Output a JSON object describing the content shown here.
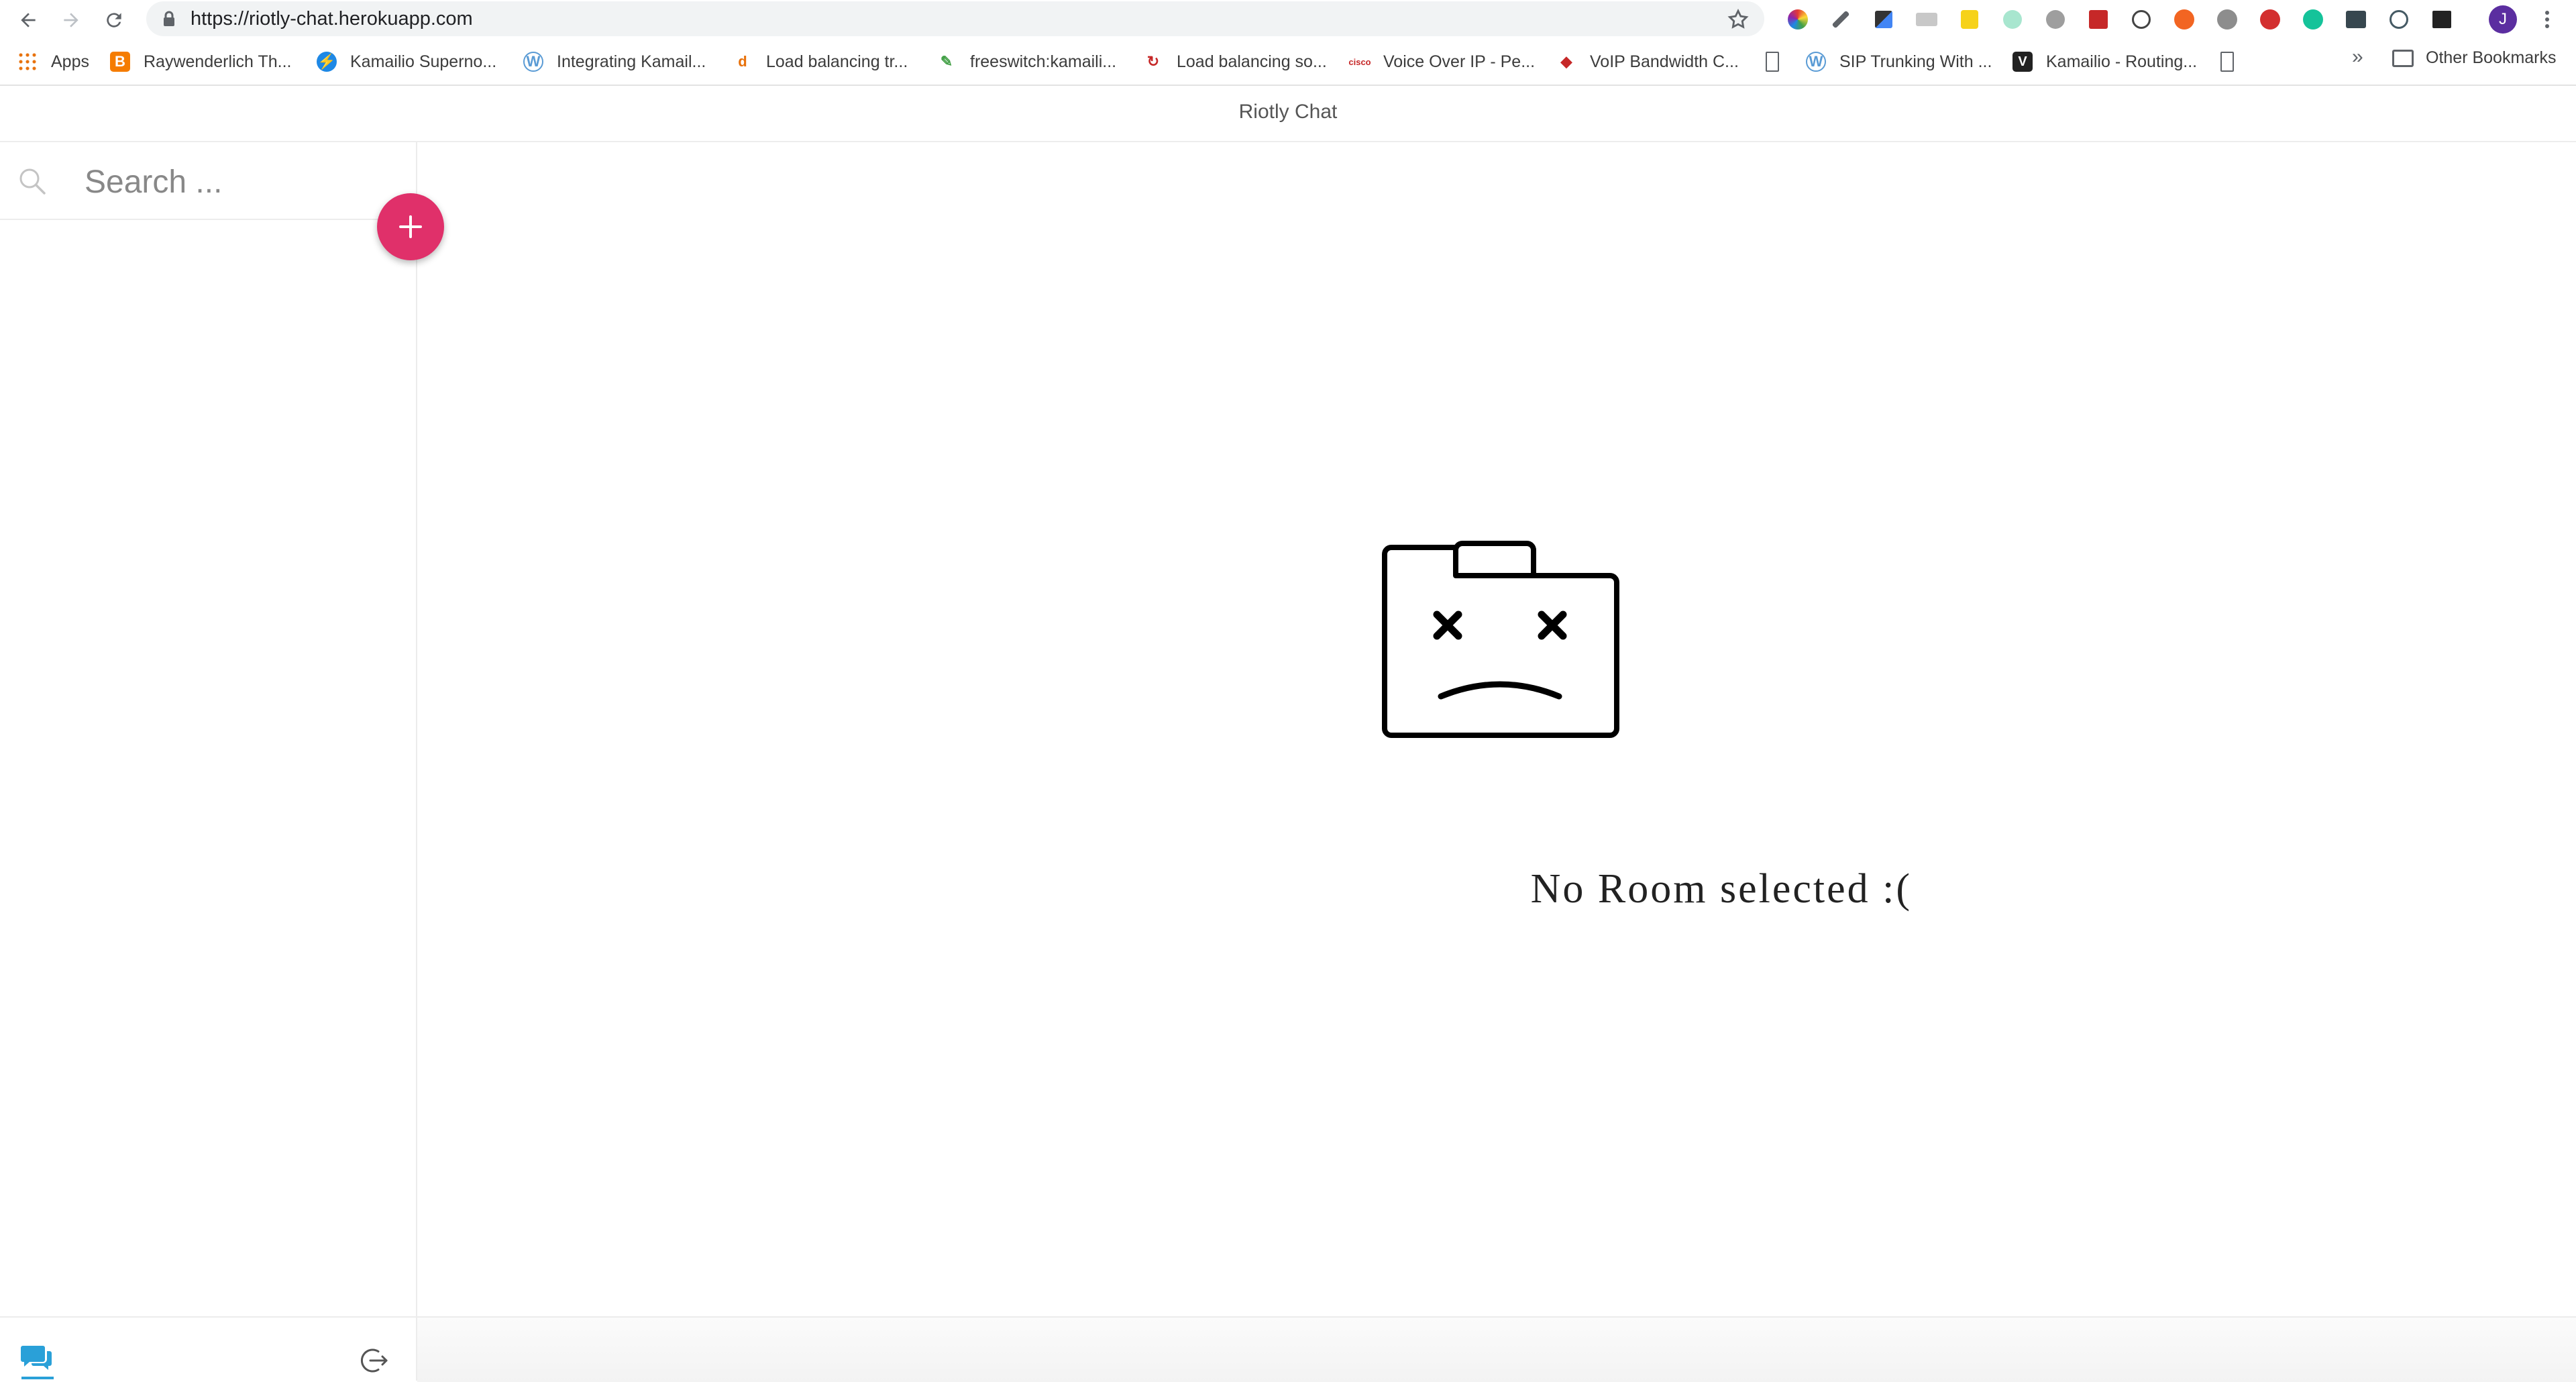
{
  "browser": {
    "url": "https://riotly-chat.herokuapp.com",
    "profile_initial": "J",
    "bookmarks": [
      {
        "label": "Apps",
        "icon": "apps-grid-icon"
      },
      {
        "label": "Raywenderlich Th...",
        "icon": "blogger-icon"
      },
      {
        "label": "Kamailio Superno...",
        "icon": "bolt-icon"
      },
      {
        "label": "Integrating Kamail...",
        "icon": "wordpress-icon"
      },
      {
        "label": "Load balancing tr...",
        "icon": "d-icon"
      },
      {
        "label": "freeswitch:kamaili...",
        "icon": "edit-icon"
      },
      {
        "label": "Load balancing so...",
        "icon": "refresh-red-icon"
      },
      {
        "label": "Voice Over IP - Pe...",
        "icon": "cisco-icon"
      },
      {
        "label": "VoIP Bandwidth C...",
        "icon": "diamond-icon"
      },
      {
        "label": "",
        "icon": "page-icon"
      },
      {
        "label": "SIP Trunking With ...",
        "icon": "wordpress-icon"
      },
      {
        "label": "Kamailio - Routing...",
        "icon": "v-icon"
      },
      {
        "label": "",
        "icon": "page-icon"
      }
    ],
    "overflow": "»",
    "other_bookmarks": "Other Bookmarks"
  },
  "app": {
    "title": "Riotly Chat"
  },
  "sidebar": {
    "search_placeholder": "Search ..."
  },
  "main": {
    "empty_message": "No Room selected :("
  },
  "colors": {
    "accent_pink": "#e0306a",
    "active_tab_blue": "#2aa0d8"
  }
}
